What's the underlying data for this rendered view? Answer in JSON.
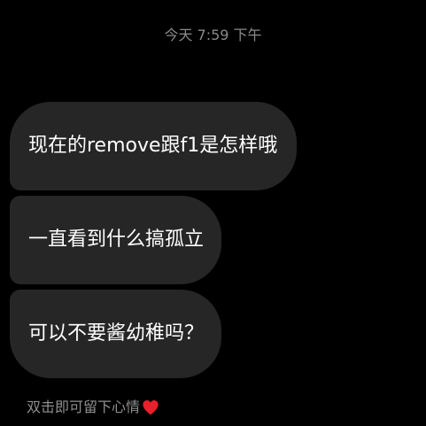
{
  "header": {
    "timestamp": "今天 7:59 下午"
  },
  "messages": [
    {
      "text": "现在的remove跟f1是怎样哦"
    },
    {
      "text": "一直看到什么搞孤立"
    },
    {
      "text": "可以不要酱幼稚吗？"
    }
  ],
  "footer": {
    "reaction_hint": "双击即可留下心情",
    "reaction_icon": "heart-icon",
    "heart_color": "#e8202c"
  },
  "colors": {
    "background": "#000000",
    "bubble": "#262626",
    "text": "#ffffff",
    "secondary_text": "#8a8a8a"
  }
}
